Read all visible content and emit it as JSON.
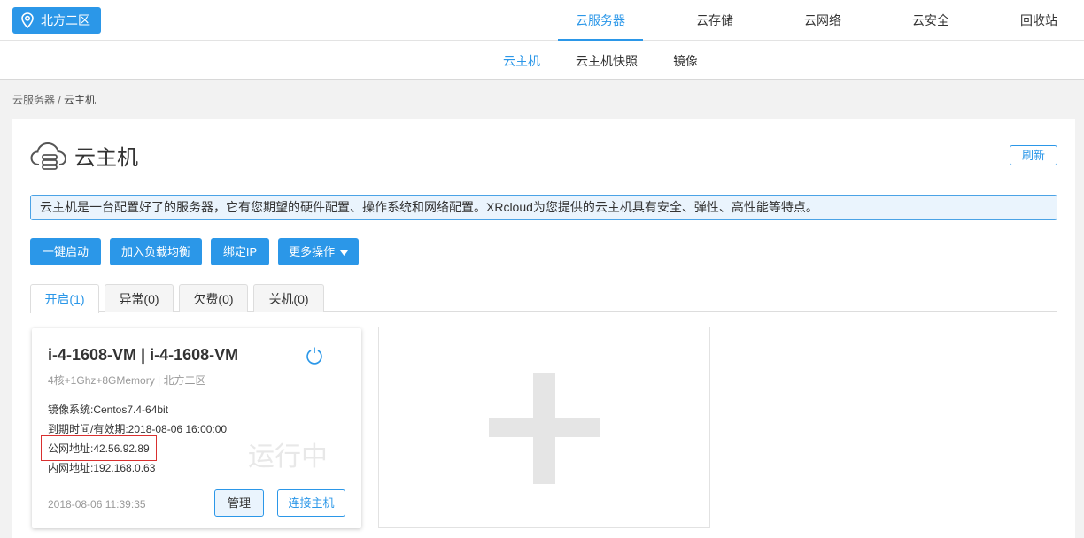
{
  "region": {
    "label": "北方二区",
    "icon": "location-pin-icon"
  },
  "main_nav": [
    {
      "label": "云服务器",
      "active": true
    },
    {
      "label": "云存储",
      "active": false
    },
    {
      "label": "云网络",
      "active": false
    },
    {
      "label": "云安全",
      "active": false
    },
    {
      "label": "回收站",
      "active": false
    }
  ],
  "sub_nav": [
    {
      "label": "云主机",
      "active": true
    },
    {
      "label": "云主机快照",
      "active": false
    },
    {
      "label": "镜像",
      "active": false
    }
  ],
  "breadcrumb": {
    "parent": "云服务器",
    "separator": " / ",
    "current": "云主机"
  },
  "page": {
    "title": "云主机",
    "icon": "cloud-server-icon",
    "refresh_label": "刷新",
    "info": "云主机是一台配置好了的服务器，它有您期望的硬件配置、操作系统和网络配置。XRcloud为您提供的云主机具有安全、弹性、高性能等特点。"
  },
  "actions": [
    {
      "label": "一键启动"
    },
    {
      "label": "加入负载均衡"
    },
    {
      "label": "绑定IP"
    },
    {
      "label": "更多操作"
    }
  ],
  "tabs": [
    {
      "label": "开启(1)",
      "active": true
    },
    {
      "label": "异常(0)",
      "active": false
    },
    {
      "label": "欠费(0)",
      "active": false
    },
    {
      "label": "关机(0)",
      "active": false
    }
  ],
  "vm": {
    "name": "i-4-1608-VM | i-4-1608-VM",
    "spec": "4核+1Ghz+8GMemory | 北方二区",
    "image": "镜像系统:Centos7.4-64bit",
    "expiry": "到期时间/有效期:2018-08-06 16:00:00",
    "public_ip": "公网地址:42.56.92.89",
    "private_ip": "内网地址:192.168.0.63",
    "status": "运行中",
    "created": "2018-08-06 11:39:35",
    "manage_label": "管理",
    "connect_label": "连接主机"
  },
  "colors": {
    "accent": "#2b97e8",
    "highlight": "#d9302f"
  }
}
